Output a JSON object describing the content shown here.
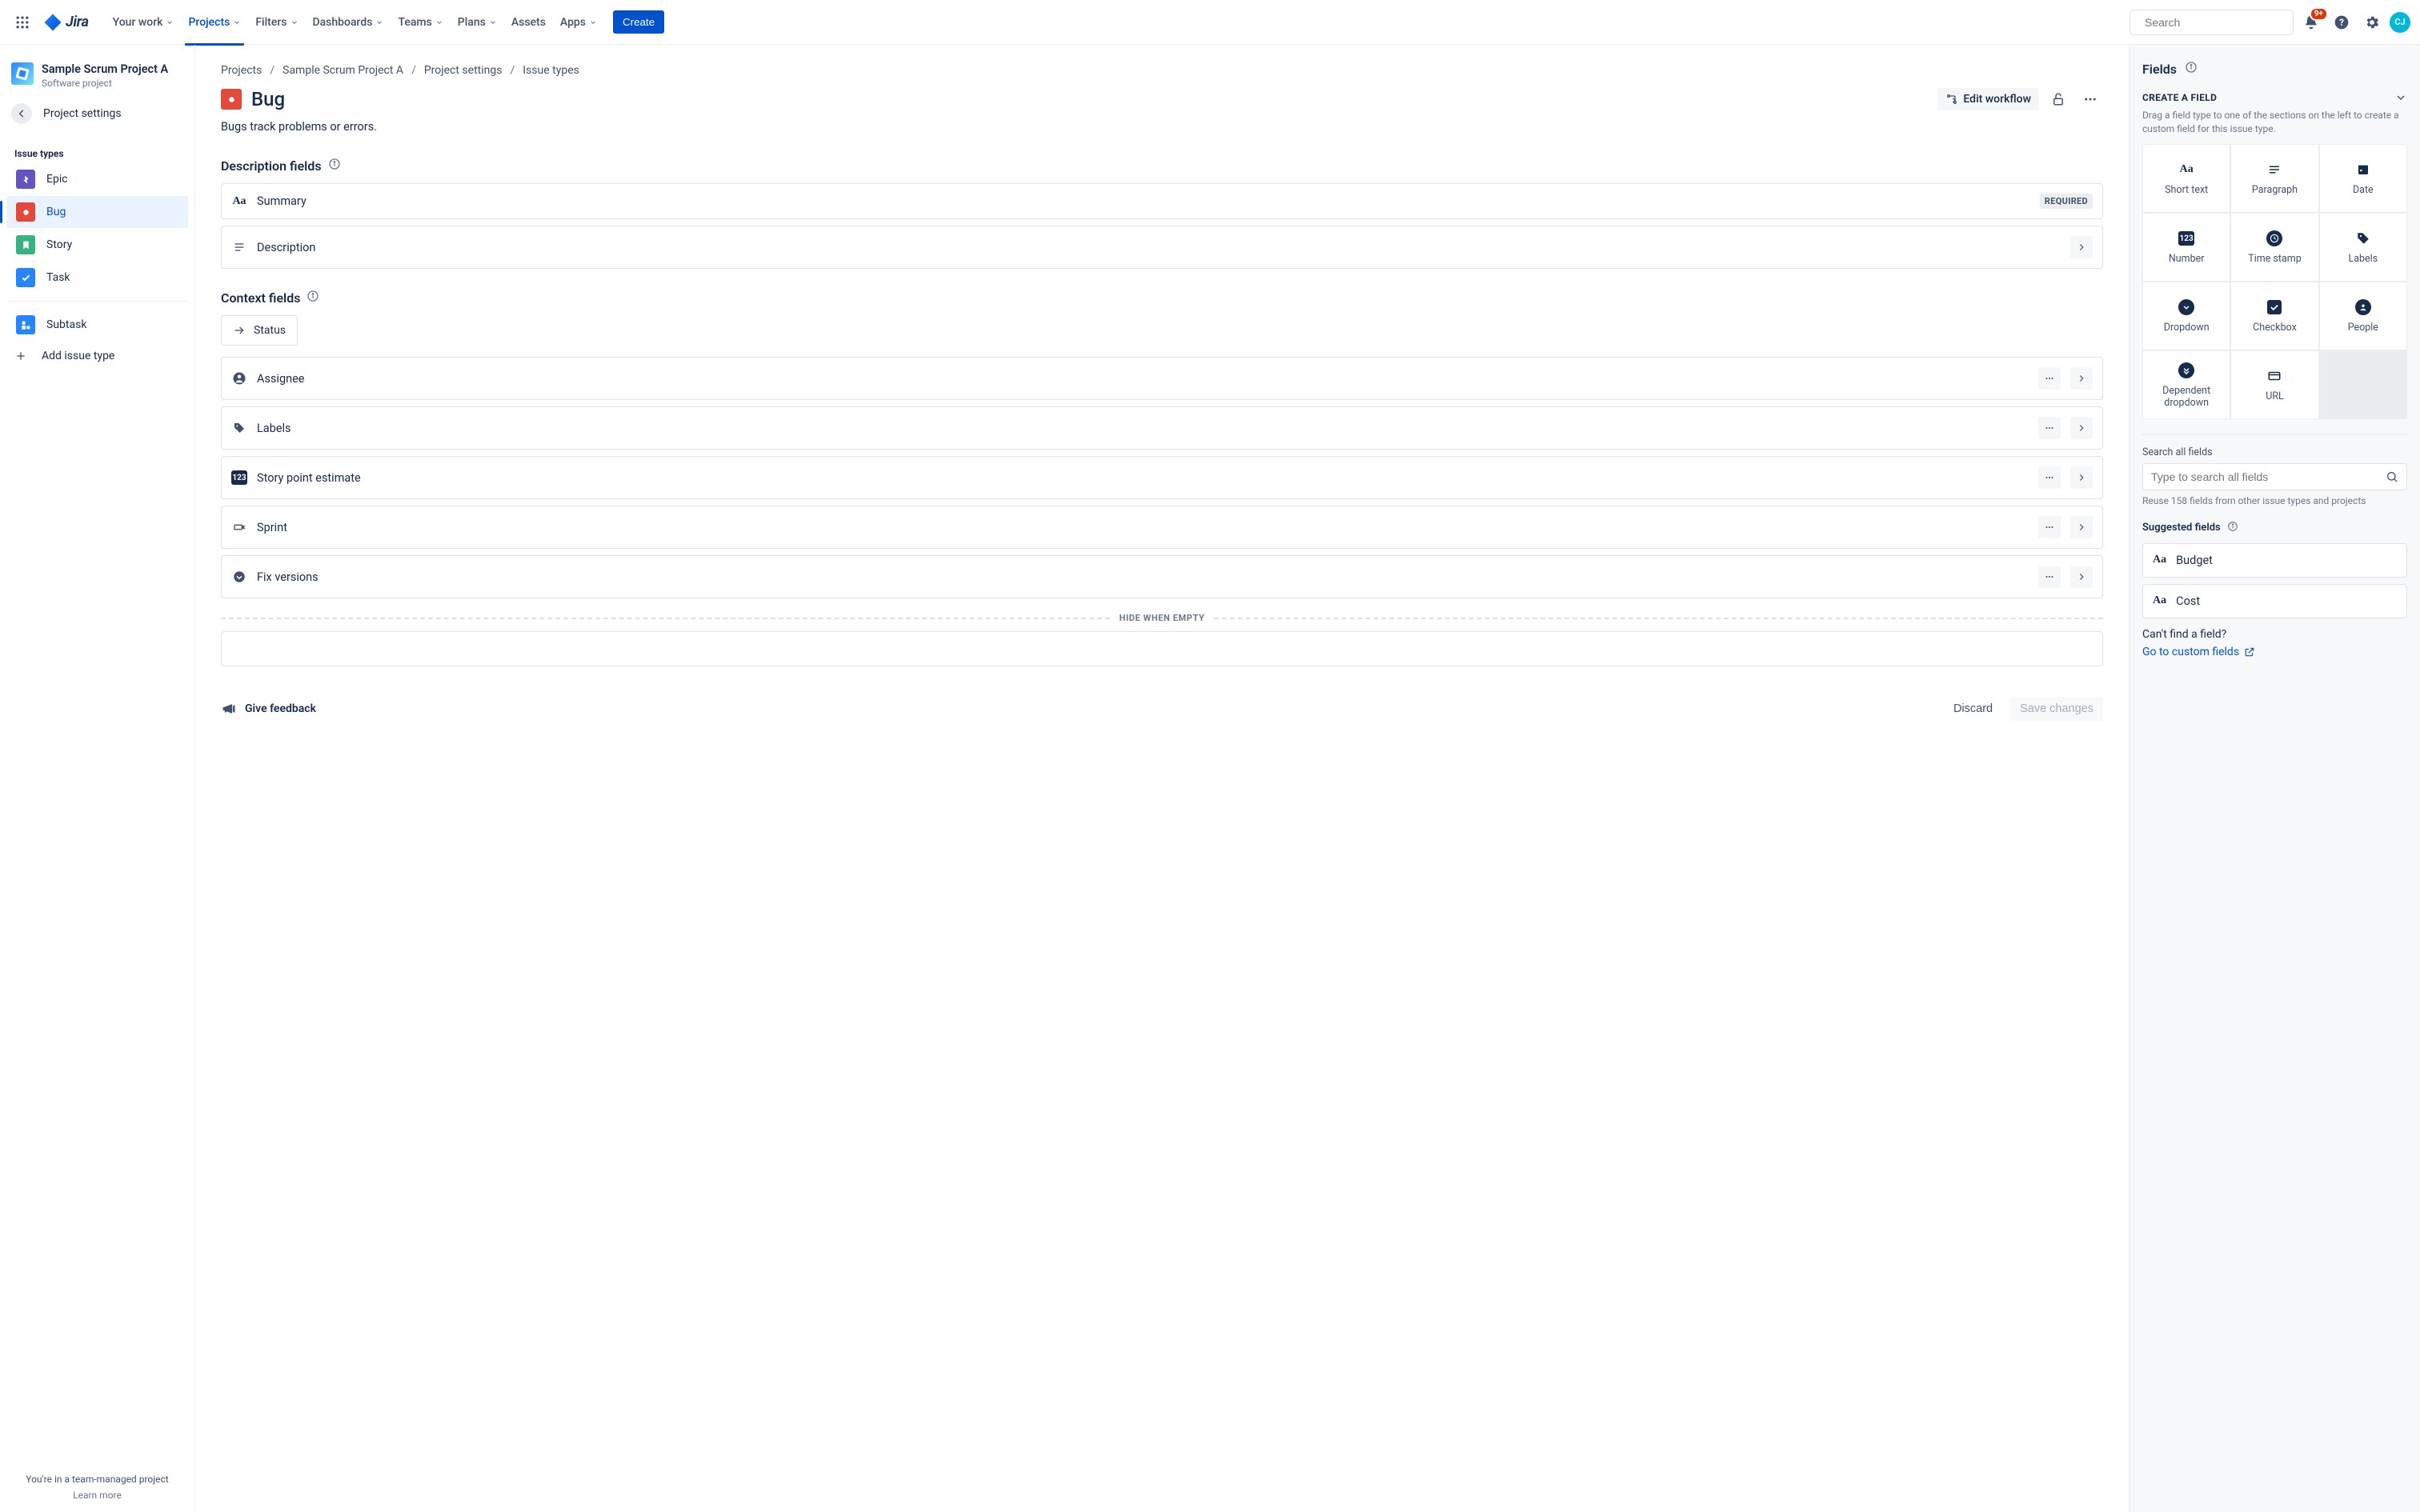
{
  "topnav": {
    "items": [
      {
        "label": "Your work"
      },
      {
        "label": "Projects"
      },
      {
        "label": "Filters"
      },
      {
        "label": "Dashboards"
      },
      {
        "label": "Teams"
      },
      {
        "label": "Plans"
      },
      {
        "label": "Assets"
      },
      {
        "label": "Apps"
      }
    ],
    "active_index": 1,
    "create_label": "Create",
    "search_placeholder": "Search",
    "notif_badge": "9+",
    "avatar_initials": "CJ"
  },
  "sidebar": {
    "project_name": "Sample Scrum Project A",
    "project_type": "Software project",
    "back_label": "Project settings",
    "section_heading": "Issue types",
    "issue_types": [
      {
        "key": "epic",
        "label": "Epic"
      },
      {
        "key": "bug",
        "label": "Bug"
      },
      {
        "key": "story",
        "label": "Story"
      },
      {
        "key": "task",
        "label": "Task"
      }
    ],
    "selected_index": 1,
    "subtask_label": "Subtask",
    "add_label": "Add issue type",
    "footer_line1": "You're in a team-managed project",
    "footer_line2": "Learn more"
  },
  "breadcrumbs": [
    "Projects",
    "Sample Scrum Project A",
    "Project settings",
    "Issue types"
  ],
  "page": {
    "title": "Bug",
    "description": "Bugs track problems or errors.",
    "edit_workflow_label": "Edit workflow"
  },
  "sections": {
    "description": {
      "heading": "Description fields",
      "fields": [
        {
          "icon": "aa",
          "label": "Summary",
          "required": true
        },
        {
          "icon": "paragraph",
          "label": "Description",
          "expandable": true
        }
      ]
    },
    "context": {
      "heading": "Context fields",
      "status_label": "Status",
      "fields": [
        {
          "icon": "person",
          "label": "Assignee"
        },
        {
          "icon": "tag",
          "label": "Labels"
        },
        {
          "icon": "num",
          "label": "Story point estimate"
        },
        {
          "icon": "sprint",
          "label": "Sprint"
        },
        {
          "icon": "dropdown",
          "label": "Fix versions"
        }
      ],
      "hide_divider_label": "HIDE WHEN EMPTY"
    }
  },
  "required_badge": "REQUIRED",
  "actions": {
    "feedback": "Give feedback",
    "discard": "Discard",
    "save": "Save changes"
  },
  "right": {
    "title": "Fields",
    "create_heading": "CREATE A FIELD",
    "create_desc": "Drag a field type to one of the sections on the left to create a custom field for this issue type.",
    "field_types": [
      {
        "icon": "aa",
        "label": "Short text"
      },
      {
        "icon": "para",
        "label": "Paragraph"
      },
      {
        "icon": "date",
        "label": "Date"
      },
      {
        "icon": "num",
        "label": "Number"
      },
      {
        "icon": "time",
        "label": "Time stamp"
      },
      {
        "icon": "tag",
        "label": "Labels"
      },
      {
        "icon": "dropdown",
        "label": "Dropdown"
      },
      {
        "icon": "check",
        "label": "Checkbox"
      },
      {
        "icon": "people",
        "label": "People"
      },
      {
        "icon": "depdrop",
        "label": "Dependent dropdown"
      },
      {
        "icon": "url",
        "label": "URL"
      }
    ],
    "search_label": "Search all fields",
    "search_placeholder": "Type to search all fields",
    "reuse_hint_prefix": "Reuse ",
    "reuse_count": "158",
    "reuse_hint_suffix": " fields from other issue types and projects",
    "suggested_heading": "Suggested fields",
    "suggested": [
      {
        "label": "Budget"
      },
      {
        "label": "Cost"
      }
    ],
    "not_found_q": "Can't find a field?",
    "custom_link": "Go to custom fields"
  }
}
